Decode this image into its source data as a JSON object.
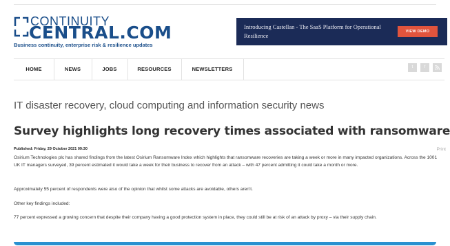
{
  "logo": {
    "top_text": "CONTINUITY",
    "main_text": "CENTRAL.COM",
    "tagline": "Business continuity, enterprise risk & resilience updates"
  },
  "ad": {
    "text": "Introducing Castellan - The SaaS Platform for Operational Resilience",
    "button_label": "VIEW DEMO"
  },
  "nav": {
    "items": [
      "HOME",
      "NEWS",
      "JOBS",
      "RESOURCES",
      "NEWSLETTERS"
    ],
    "social": [
      "t",
      "f",
      "rss"
    ]
  },
  "section_title": "IT disaster recovery, cloud computing and information security news",
  "article": {
    "headline": "Survey highlights long recovery times associated with ransomware",
    "published": "Published: Friday, 29 October 2021 09:30",
    "print_label": "Print",
    "paragraphs": [
      "Osirium Technologies plc has shared findings from the latest Osirium Ransomware Index which highlights that ransomware recoveries are taking a week or more in many impacted organizations. Across the 1001 UK IT managers surveyed, 39 percent estimated it would take a week for their business to recover from an attack – with 47 percent admitting it could take a month or more.",
      "Approximately 55 percent of respondents were also of the opinion that whilst some attacks are avoidable, others aren't.",
      "Other key findings included:",
      "77 percent expressed a growing concern that despite their company having a good protection system in place, they could still be at risk of an attack by proxy – via their supply chain."
    ]
  },
  "colors": {
    "brand_blue": "#1a4e8a",
    "ad_bg": "#1b2b57",
    "ad_button": "#e1543d",
    "accent_bar": "#2a91d0"
  }
}
